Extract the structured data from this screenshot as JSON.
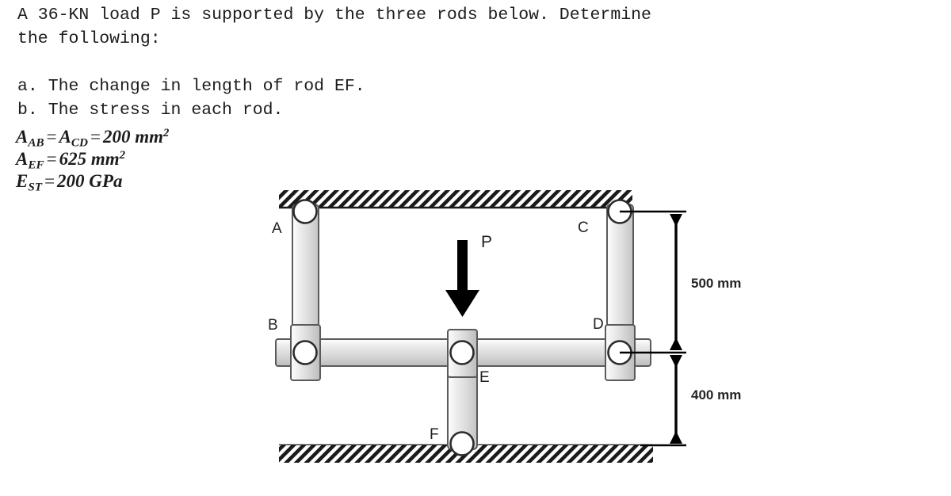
{
  "problem": {
    "statement_line_1": "A 36-KN load P is supported by the three rods below. Determine",
    "statement_line_2": "the following:",
    "item_a": "a. The change in length of rod EF.",
    "item_b": "b. The stress in each rod.",
    "givens": [
      {
        "id": "area-ab-cd",
        "symbol_1": "A",
        "subscript_1": "AB",
        "symbol_2": "A",
        "subscript_2": "CD",
        "value": "200 mm",
        "exponent": "2"
      },
      {
        "id": "area-ef",
        "symbol_1": "A",
        "subscript_1": "EF",
        "value": "625 mm",
        "exponent": "2"
      },
      {
        "id": "modulus-steel",
        "symbol_1": "E",
        "subscript_1": "ST",
        "value": "200 GPa",
        "exponent": ""
      }
    ],
    "equals_sign": "="
  },
  "diagram": {
    "joints": {
      "a": "A",
      "b": "B",
      "c": "C",
      "d": "D",
      "e": "E",
      "f": "F"
    },
    "load": {
      "label": "P",
      "magnitude": "36 KN",
      "direction": "down"
    },
    "dimensions": {
      "upper": "500 mm",
      "lower": "400 mm"
    },
    "rods": [
      {
        "name": "AB",
        "area": "200 mm^2",
        "orientation": "vertical",
        "top_support": "ceiling-pin-a",
        "bottom_joint": "B"
      },
      {
        "name": "CD",
        "area": "200 mm^2",
        "orientation": "vertical",
        "top_support": "ceiling-pin-c",
        "bottom_joint": "D"
      },
      {
        "name": "EF",
        "area": "625 mm^2",
        "orientation": "vertical",
        "top_joint": "E",
        "bottom_support": "ground-pin-f"
      }
    ],
    "supports": {
      "ceiling": "hatched-fixed-support",
      "ground": "hatched-fixed-support"
    },
    "colors": {
      "rod_light": "#f2f2f2",
      "rod_mid": "#d9d9d9",
      "rod_dark": "#b9b9b9",
      "outline": "#555555",
      "hatch": "#1a1a1a",
      "arrow": "#000000",
      "text": "#1c1c1c"
    }
  }
}
